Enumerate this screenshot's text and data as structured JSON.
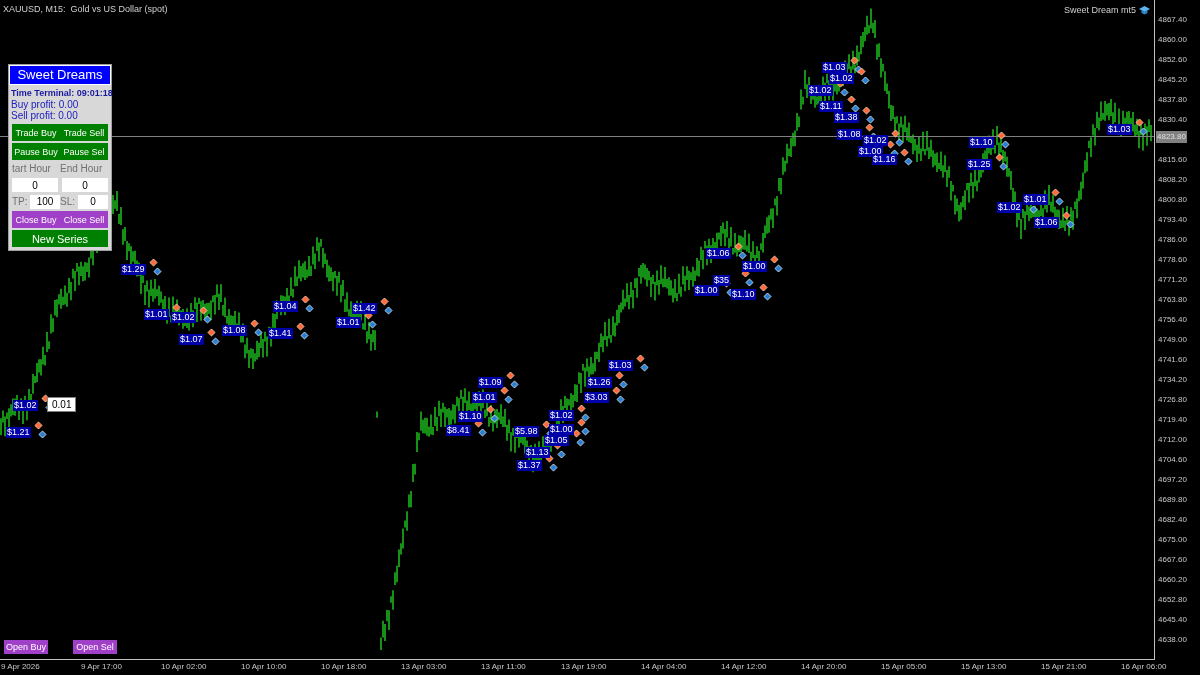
{
  "chart": {
    "symbol_title": "XAUUSD, M15:  Gold vs US Dollar (spot)",
    "expert_name": "Sweet Dream mt5",
    "current_price": "4823.80",
    "lot_label": "0.01",
    "trade_labels": [
      "$1.29",
      "$1.01",
      "$1.02",
      "$1.07",
      "$1.08",
      "$1.04",
      "$1.41",
      "$1.01",
      "$1.42",
      "$1.09",
      "$1.01",
      "$1.10",
      "$8.41",
      "$1.02",
      "$1.00",
      "$1.05",
      "$5.98",
      "$1.13",
      "$1.37",
      "$1.26",
      "$3.03",
      "$1.03",
      "$1.00",
      "$35",
      "$1.10",
      "$1.00",
      "$1.06",
      "$1.03",
      "$1.02",
      "$1.02",
      "$1.11",
      "$1.38",
      "$1.08",
      "$1.02",
      "$1.00",
      "$1.16",
      "$1.10",
      "$1.25",
      "$1.02",
      "$1.01",
      "$1.06",
      "$1.03",
      "$1.21",
      "$1.02"
    ],
    "price_axis": [
      "4867.40",
      "4860.00",
      "4852.60",
      "4845.20",
      "4837.80",
      "4830.40",
      "4815.60",
      "4808.20",
      "4800.80",
      "4793.40",
      "4786.00",
      "4778.60",
      "4771.20",
      "4763.80",
      "4756.40",
      "4749.00",
      "4741.60",
      "4734.20",
      "4726.80",
      "4719.40",
      "4712.00",
      "4704.60",
      "4697.20",
      "4689.80",
      "4682.40",
      "4675.00",
      "4667.60",
      "4660.20",
      "4652.80",
      "4645.40",
      "4638.00"
    ],
    "time_axis": [
      "9 Apr 2026",
      "9 Apr 17:00",
      "10 Apr 02:00",
      "10 Apr 10:00",
      "10 Apr 18:00",
      "13 Apr 03:00",
      "13 Apr 11:00",
      "13 Apr 19:00",
      "14 Apr 04:00",
      "14 Apr 12:00",
      "14 Apr 20:00",
      "15 Apr 05:00",
      "15 Apr 13:00",
      "15 Apr 21:00",
      "16 Apr 06:00"
    ]
  },
  "panel": {
    "title": "Sweet Dreams",
    "time_terminal": "Time Terminal: 09:01:18",
    "buy_profit": "Buy profit: 0.00",
    "sell_profit": "Sell profit: 0.00",
    "trade_buttons": [
      "Trade Buy",
      "Trade Sell"
    ],
    "pause_buttons": [
      "Pause Buy",
      "Pause Sel"
    ],
    "hour_labels": [
      "tart Hour",
      "End Hour"
    ],
    "hour_fields": [
      "0",
      "0"
    ],
    "tp": {
      "label": "TP:",
      "value": "100"
    },
    "sl": {
      "label": "SL:",
      "value": "0"
    },
    "close_buttons": [
      "Close Buy",
      "Close Sell"
    ],
    "new_series_button": "New Series"
  },
  "bottom_buttons": [
    "Open Buy",
    "Open Sel"
  ]
}
